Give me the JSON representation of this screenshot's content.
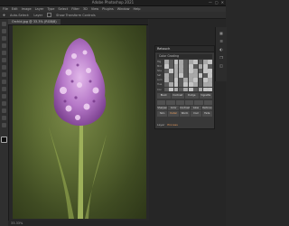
{
  "window": {
    "title": "Adobe Photoshop 2021",
    "controls": [
      "—",
      "▢",
      "✕"
    ]
  },
  "menubar": {
    "items": [
      "File",
      "Edit",
      "Image",
      "Layer",
      "Type",
      "Select",
      "Filter",
      "3D",
      "View",
      "Plugins",
      "Window",
      "Help"
    ]
  },
  "options": {
    "items": [
      "Auto-Select:",
      "Layer",
      "Show Transform Controls"
    ]
  },
  "document_tab": {
    "label": "Orchid.jpg @ 33.3% (RGB/8)"
  },
  "status": {
    "text": "33.33%"
  },
  "panel": {
    "title": "Retouch",
    "subheader": "Color Grading",
    "row_labels": [
      "Hig",
      "Mid",
      "Sha",
      "Sat",
      "Lum",
      "Hue",
      "Con"
    ],
    "buttons_row1": [
      "Black",
      "Contrast",
      "Dodge",
      "Vignette"
    ],
    "buttons_row2": [
      "Sharpen",
      "Color",
      "Contrast",
      "Glow",
      "Defocus"
    ],
    "buttons_row3": [
      "Skin",
      "Detail",
      "Warm",
      "Cool",
      "Fade"
    ],
    "footer_left": "Layer",
    "footer_right": "Process"
  },
  "colors": {
    "accent": "#e89a5c",
    "flower": "#b678c8",
    "background": "#5e6d34"
  }
}
